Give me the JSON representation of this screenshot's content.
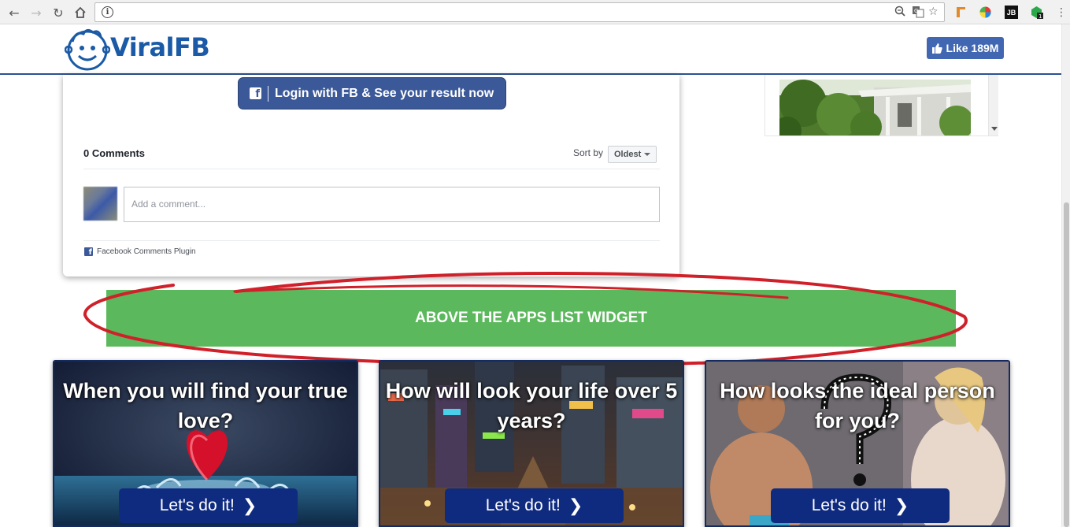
{
  "browser": {
    "back_icon": "arrow-left",
    "forward_icon": "arrow-right",
    "reload_icon": "reload",
    "home_icon": "home",
    "info_icon": "info",
    "url": ""
  },
  "site": {
    "logo_text": "ViralFB",
    "like_label": "Like 189M"
  },
  "comments_card": {
    "login_button": "Login with FB & See your result now",
    "comments_count": "0 Comments",
    "sort_label": "Sort by",
    "sort_value": "Oldest",
    "comment_placeholder": "Add a comment...",
    "plugin_label": "Facebook Comments Plugin"
  },
  "widget": {
    "label": "ABOVE THE APPS LIST WIDGET"
  },
  "apps": [
    {
      "title": "When you will find your true love?",
      "button": "Let's do it!"
    },
    {
      "title": "How will look your life over 5 years?",
      "button": "Let's do it!"
    },
    {
      "title": "How looks the ideal person for you?",
      "button": "Let's do it!"
    }
  ],
  "colors": {
    "brand_blue": "#1a5aa6",
    "facebook_blue": "#3b5998",
    "widget_green": "#5cb85c",
    "annotation_red": "#d0202a",
    "app_button": "#0f2b80"
  }
}
